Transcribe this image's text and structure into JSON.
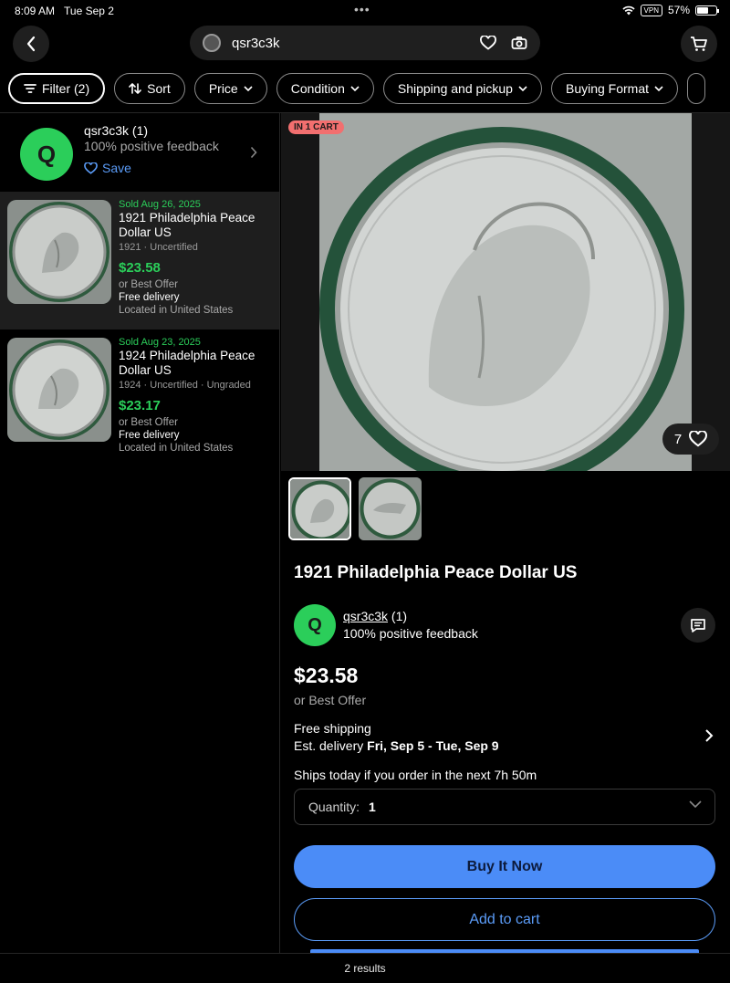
{
  "status": {
    "time": "8:09 AM",
    "date": "Tue Sep 2",
    "vpn": "VPN",
    "battery": "57%"
  },
  "search": {
    "query": "qsr3c3k"
  },
  "filters": [
    {
      "label": "Filter (2)"
    },
    {
      "label": "Sort"
    },
    {
      "label": "Price"
    },
    {
      "label": "Condition"
    },
    {
      "label": "Shipping and pickup"
    },
    {
      "label": "Buying Format"
    }
  ],
  "seller": {
    "initial": "Q",
    "name": "qsr3c3k (1)",
    "username": "qsr3c3k",
    "count": "(1)",
    "feedback": "100% positive feedback",
    "save_label": "Save"
  },
  "listings": [
    {
      "sold": "Sold  Aug 26, 2025",
      "title": "1921 Philadelphia Peace Dollar US",
      "subtitle": "1921 · Uncertified",
      "price": "$23.58",
      "offer": "or Best Offer",
      "delivery": "Free delivery",
      "location": "Located in United States"
    },
    {
      "sold": "Sold  Aug 23, 2025",
      "title": "1924 Philadelphia Peace Dollar US",
      "subtitle": "1924 · Uncertified · Ungraded",
      "price": "$23.17",
      "offer": "or Best Offer",
      "delivery": "Free delivery",
      "location": "Located in United States"
    }
  ],
  "detail": {
    "badge": "IN 1 CART",
    "likes": "7",
    "title": "1921 Philadelphia Peace Dollar US",
    "price": "$23.58",
    "offer": "or Best Offer",
    "shipping": "Free shipping",
    "delivery_prefix": "Est. delivery ",
    "delivery_dates": "Fri, Sep 5 - Tue, Sep 9",
    "ships_today": "Ships today if you order in the next 7h 50m",
    "quantity_label": "Quantity:",
    "quantity_value": "1",
    "buy_label": "Buy It Now",
    "cart_label": "Add to cart"
  },
  "footer": {
    "results": "2 results"
  },
  "colors": {
    "accent_green": "#2bce5a",
    "accent_blue": "#4b8cf7",
    "badge_red": "#f26f6f"
  }
}
